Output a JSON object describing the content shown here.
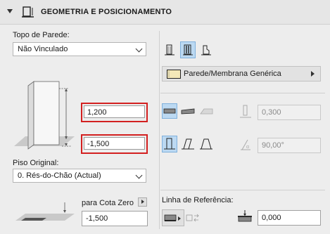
{
  "header": {
    "title": "GEOMETRIA E POSICIONAMENTO"
  },
  "left": {
    "wall_top_label": "Topo de Parede:",
    "wall_top_value": "Não Vinculado",
    "top_offset_value": "1,200",
    "bottom_offset_value": "-1,500",
    "home_story_label": "Piso Original:",
    "home_story_value": "0. Rés-do-Chão (Actual)",
    "zero_ref_label": "para Cota Zero",
    "zero_ref_value": "-1,500"
  },
  "right": {
    "building_material": "Parede/Membrana Genérica",
    "thickness_value": "0,300",
    "angle_value": "90,00°",
    "ref_line_label": "Linha de Referência:",
    "ref_offset_value": "0,000"
  },
  "colors": {
    "highlight_border": "#d32020",
    "selected_bg": "#bcd9f2"
  }
}
